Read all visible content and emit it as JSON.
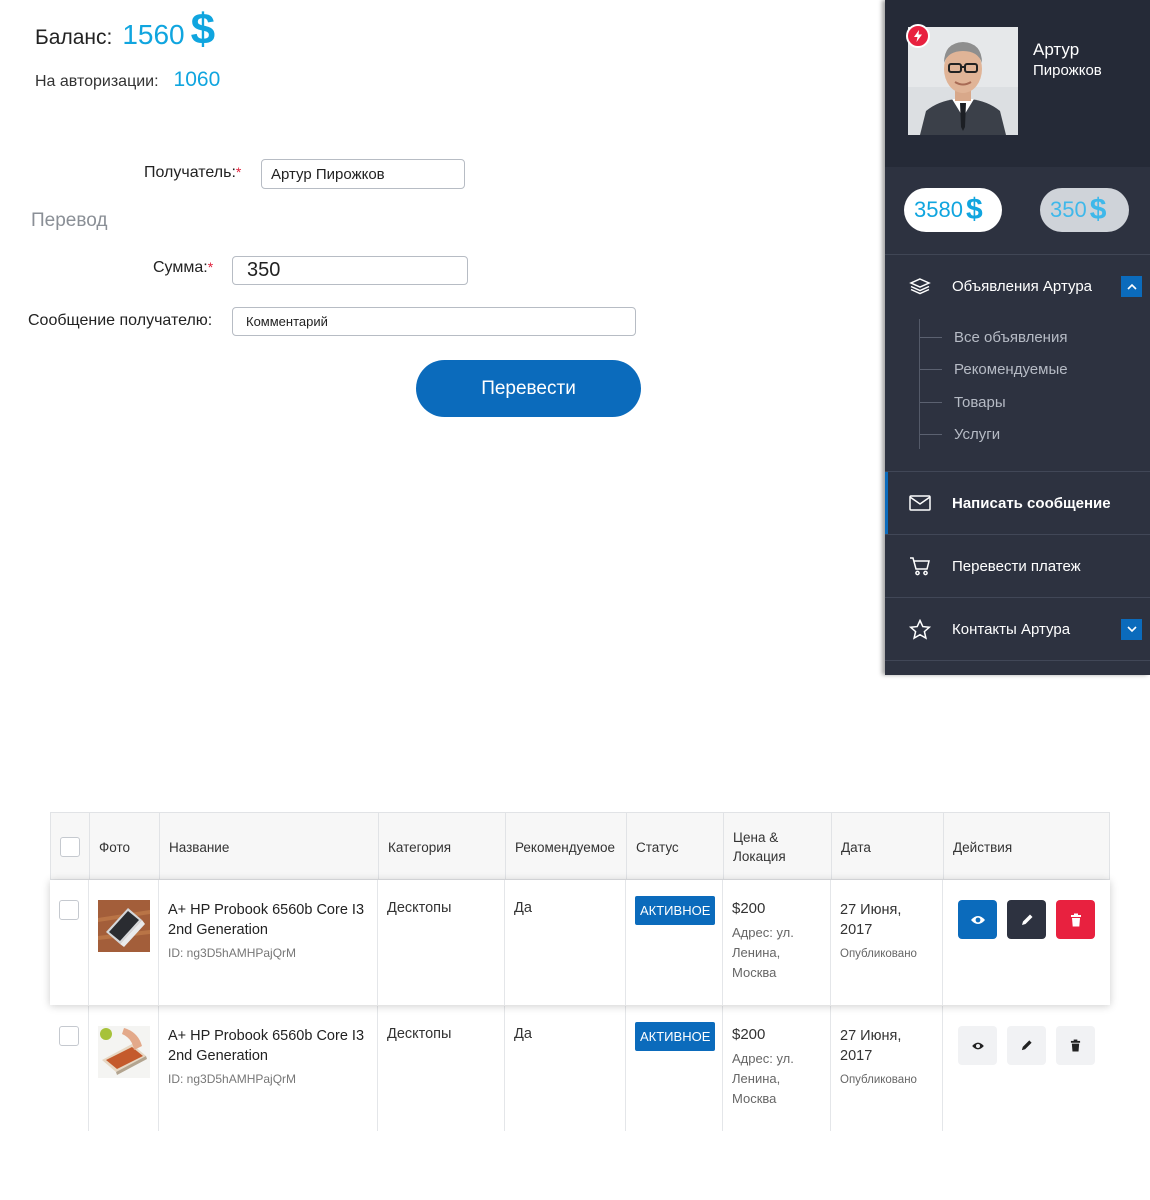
{
  "balance": {
    "label": "Баланс:",
    "value": "1560",
    "currency": "$"
  },
  "authorization": {
    "label": "На авторизации:",
    "value": "1060"
  },
  "form": {
    "recipient_label": "Получатель:",
    "recipient_value": "Артур Пирожков",
    "section_title": "Перевод",
    "amount_label": "Сумма:",
    "amount_value": "350",
    "message_label": "Сообщение получателю:",
    "message_placeholder": "Комментарий",
    "required_mark": "*",
    "submit_label": "Перевести"
  },
  "sidebar": {
    "profile": {
      "first_name": "Артур",
      "last_name": "Пирожков"
    },
    "wallet_main": "3580",
    "wallet_second": "350",
    "currency": "$",
    "menu": [
      {
        "label": "Объявления Артура",
        "icon": "layers-icon"
      },
      {
        "label": "Написать сообщение",
        "icon": "envelope-icon"
      },
      {
        "label": "Перевести платеж",
        "icon": "cart-icon"
      },
      {
        "label": "Контакты Артура",
        "icon": "star-icon"
      }
    ],
    "submenu": [
      "Все объявления",
      "Рекомендуемые",
      "Товары",
      "Услуги"
    ],
    "accent_color": "#0b6bbc",
    "bg_color": "#2d3240"
  },
  "table": {
    "headers": [
      "Фото",
      "Название",
      "Категория",
      "Рекомендуемое",
      "Статус",
      "Цена & Локация",
      "Дата",
      "Действия"
    ],
    "rows": [
      {
        "title": "A+ HP Probook 6560b Core I3 2nd Generation",
        "id": "ID: ng3D5hAMHPajQrM",
        "category": "Десктопы",
        "featured": "Да",
        "status": "АКТИВНОЕ",
        "price": "$200",
        "address": "Адрес: ул. Ленина, Москва",
        "date": "27 Июня, 2017",
        "published": "Опубликовано"
      },
      {
        "title": "A+ HP Probook 6560b Core I3 2nd Generation",
        "id": "ID: ng3D5hAMHPajQrM",
        "category": "Десктопы",
        "featured": "Да",
        "status": "АКТИВНОЕ",
        "price": "$200",
        "address": "Адрес: ул. Ленина, Москва",
        "date": "27 Июня, 2017",
        "published": "Опубликовано"
      }
    ],
    "status_color": "#0b6bbc",
    "delete_color": "#e8213f"
  }
}
